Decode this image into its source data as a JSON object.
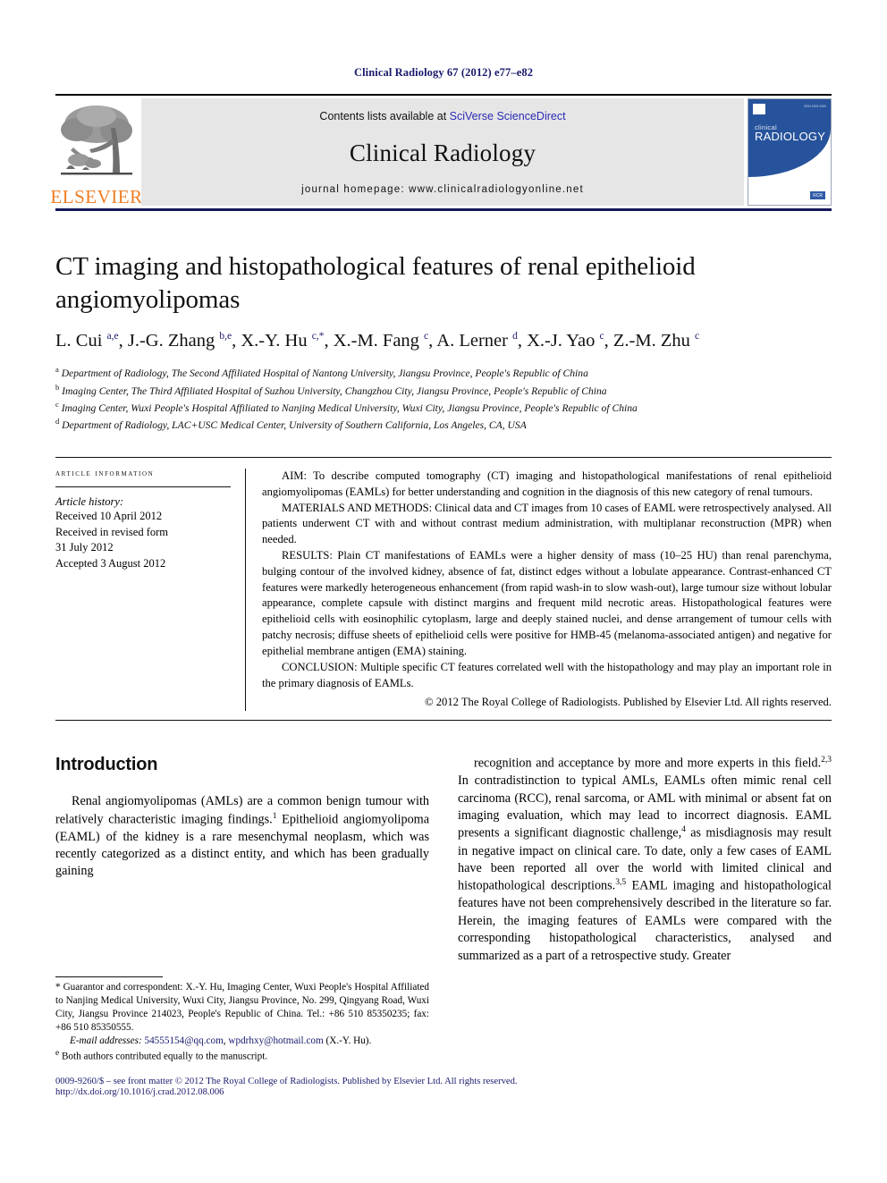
{
  "running_head": "Clinical Radiology 67 (2012) e77–e82",
  "banner": {
    "publisher_name": "ELSEVIER",
    "publisher_logo_alt": "elsevier-tree-logo",
    "contents_prefix": "Contents lists available at ",
    "contents_link": "SciVerse ScienceDirect",
    "journal_name": "Clinical Radiology",
    "homepage_label": "journal homepage: www.clinicalradiologyonline.net",
    "cover": {
      "title_line1": "clinical",
      "title_line2": "RADIOLOGY",
      "issn_text": "ISSN 0009-9260",
      "badge_text": "RCR"
    }
  },
  "article": {
    "title": "CT imaging and histopathological features of renal epithelioid angiomyolipomas",
    "authors_html": "L. Cui <sup>a,e</sup>, J.-G. Zhang <sup>b,e</sup>, X.-Y. Hu <sup>c,</sup><sup class=\"star\">*</sup>, X.-M. Fang <sup>c</sup>, A. Lerner <sup>d</sup>, X.-J. Yao <sup>c</sup>, Z.-M. Zhu <sup>c</sup>",
    "affiliations": [
      {
        "marker": "a",
        "text": "Department of Radiology, The Second Affiliated Hospital of Nantong University, Jiangsu Province, People's Republic of China"
      },
      {
        "marker": "b",
        "text": "Imaging Center, The Third Affiliated Hospital of Suzhou University, Changzhou City, Jiangsu Province, People's Republic of China"
      },
      {
        "marker": "c",
        "text": "Imaging Center, Wuxi People's Hospital Affiliated to Nanjing Medical University, Wuxi City, Jiangsu Province, People's Republic of China"
      },
      {
        "marker": "d",
        "text": "Department of Radiology, LAC+USC Medical Center, University of Southern California, Los Angeles, CA, USA"
      }
    ]
  },
  "article_information": {
    "heading": "ARTICLE INFORMATION",
    "history_label": "Article history:",
    "history_lines": [
      "Received 10 April 2012",
      "Received in revised form",
      "31 July 2012",
      "Accepted 3 August 2012"
    ]
  },
  "abstract": {
    "paragraphs": [
      "AIM: To describe computed tomography (CT) imaging and histopathological manifestations of renal epithelioid angiomyolipomas (EAMLs) for better understanding and cognition in the diagnosis of this new category of renal tumours.",
      "MATERIALS AND METHODS: Clinical data and CT images from 10 cases of EAML were retrospectively analysed. All patients underwent CT with and without contrast medium administration, with multiplanar reconstruction (MPR) when needed.",
      "RESULTS: Plain CT manifestations of EAMLs were a higher density of mass (10–25 HU) than renal parenchyma, bulging contour of the involved kidney, absence of fat, distinct edges without a lobulate appearance. Contrast-enhanced CT features were markedly heterogeneous enhancement (from rapid wash-in to slow wash-out), large tumour size without lobular appearance, complete capsule with distinct margins and frequent mild necrotic areas. Histopathological features were epithelioid cells with eosinophilic cytoplasm, large and deeply stained nuclei, and dense arrangement of tumour cells with patchy necrosis; diffuse sheets of epithelioid cells were positive for HMB-45 (melanoma-associated antigen) and negative for epithelial membrane antigen (EMA) staining.",
      "CONCLUSION: Multiple specific CT features correlated well with the histopathology and may play an important role in the primary diagnosis of EAMLs."
    ],
    "copyright": "© 2012 The Royal College of Radiologists. Published by Elsevier Ltd. All rights reserved."
  },
  "introduction": {
    "heading": "Introduction",
    "left_html": "Renal angiomyolipomas (AMLs) are a common benign tumour with relatively characteristic imaging findings.<sup>1</sup> Epithelioid angiomyolipoma (EAML) of the kidney is a rare mesenchymal neoplasm, which was recently categorized as a distinct entity, and which has been gradually gaining",
    "right_html": "recognition and acceptance by more and more experts in this field.<sup>2,3</sup> In contradistinction to typical AMLs, EAMLs often mimic renal cell carcinoma (RCC), renal sarcoma, or AML with minimal or absent fat on imaging evaluation, which may lead to incorrect diagnosis. EAML presents a significant diagnostic challenge,<sup>4</sup> as misdiagnosis may result in negative impact on clinical care. To date, only a few cases of EAML have been reported all over the world with limited clinical and histopathological descriptions.<sup>3,5</sup> EAML imaging and histopathological features have not been comprehensively described in the literature so far. Herein, the imaging features of EAMLs were compared with the corresponding histopathological characteristics, analysed and summarized as a part of a retrospective study. Greater"
  },
  "footnotes": {
    "correspondence_html": "* Guarantor and correspondent: X.-Y. Hu, Imaging Center, Wuxi People's Hospital Affiliated to Nanjing Medical University, Wuxi City, Jiangsu Province, No. 299, Qingyang Road, Wuxi City, Jiangsu Province 214023, People's Republic of China. Tel.: +86 510 85350235; fax: +86 510 85350555.",
    "email_html": "<i>E-mail addresses:</i> <span class=\"mail\">54555154@qq.com</span>, <span class=\"mail\">wpdrhxy@hotmail.com</span> (X.-Y. Hu).",
    "equal_contribution_html": "<sup>e</sup> Both authors contributed equally to the manuscript."
  },
  "page_footer": {
    "front_matter": "0009-9260/$ – see front matter © 2012 The Royal College of Radiologists. Published by Elsevier Ltd. All rights reserved.",
    "doi": "http://dx.doi.org/10.1016/j.crad.2012.08.006"
  }
}
